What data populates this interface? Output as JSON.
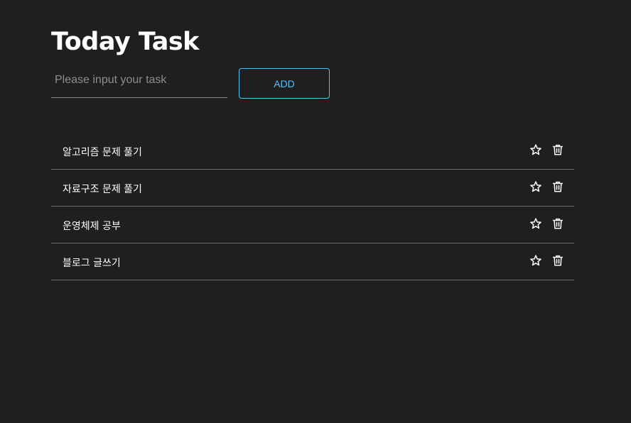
{
  "header": {
    "title": "Today Task"
  },
  "form": {
    "input_value": "",
    "input_placeholder": "Please input your task",
    "add_label": "ADD"
  },
  "tasks": [
    {
      "text": "알고리즘 문제 풀기",
      "starred": false
    },
    {
      "text": "자료구조 문제 풀기",
      "starred": false
    },
    {
      "text": "운영체제 공부",
      "starred": false
    },
    {
      "text": "블로그 글쓰기",
      "starred": false
    }
  ],
  "icons": {
    "star": "star-outline-icon",
    "delete": "trash-icon"
  },
  "colors": {
    "background": "#1f1f1f",
    "accent": "#4fc3f7",
    "text": "#ffffff",
    "divider": "#6e6e6e"
  }
}
